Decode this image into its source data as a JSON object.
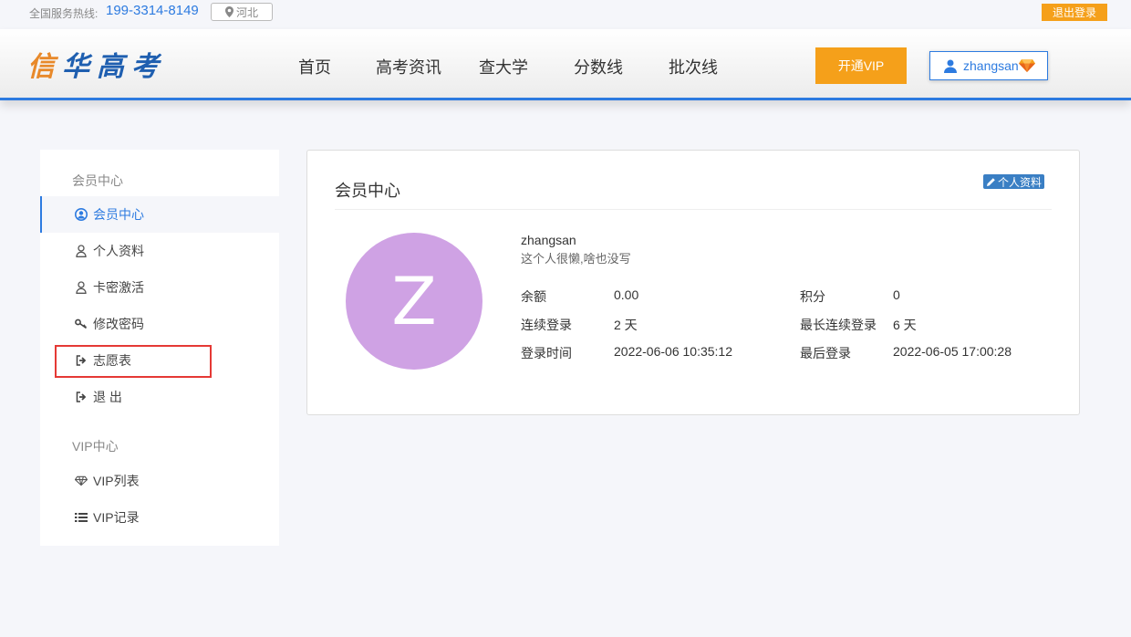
{
  "topbar": {
    "hotline_label": "全国服务热线:",
    "hotline_number": "199-3314-8149",
    "region": "河北",
    "logout": "退出登录"
  },
  "header": {
    "logo_first": "信",
    "logo_rest": "华高考",
    "nav": [
      "首页",
      "高考资讯",
      "查大学",
      "分数线",
      "批次线"
    ],
    "vip_button": "开通VIP",
    "username": "zhangsan"
  },
  "sidebar": {
    "section_member": "会员中心",
    "items_member": [
      {
        "label": "会员中心",
        "icon": "user-circle-icon"
      },
      {
        "label": "个人资料",
        "icon": "user-icon"
      },
      {
        "label": "卡密激活",
        "icon": "user-icon"
      },
      {
        "label": "修改密码",
        "icon": "key-icon"
      },
      {
        "label": "志愿表",
        "icon": "sign-out-icon"
      },
      {
        "label": "退 出",
        "icon": "sign-out-icon"
      }
    ],
    "section_vip": "VIP中心",
    "items_vip": [
      {
        "label": "VIP列表",
        "icon": "diamond-icon"
      },
      {
        "label": "VIP记录",
        "icon": "list-icon"
      }
    ]
  },
  "card": {
    "title": "会员中心",
    "edit_profile": "个人资料",
    "avatar_letter": "Z",
    "username": "zhangsan",
    "bio": "这个人很懒,啥也没写",
    "stats": {
      "balance_label": "余额",
      "balance": "0.00",
      "points_label": "积分",
      "points": "0",
      "streak_label": "连续登录",
      "streak": "2 天",
      "max_streak_label": "最长连续登录",
      "max_streak": "6 天",
      "login_time_label": "登录时间",
      "login_time": "2022-06-06 10:35:12",
      "last_login_label": "最后登录",
      "last_login": "2022-06-05 17:00:28"
    }
  },
  "colors": {
    "accent_blue": "#2d7be0",
    "orange": "#f5a01a",
    "avatar_bg": "#cfa2e4",
    "highlight_red": "#e53935"
  }
}
